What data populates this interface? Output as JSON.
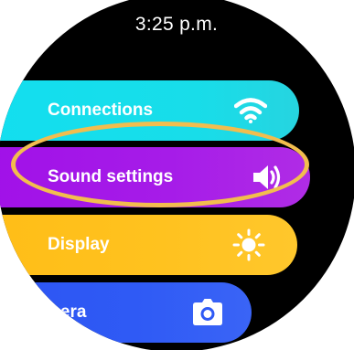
{
  "status_bar": {
    "time": "3:25 p.m."
  },
  "menu": {
    "items": [
      {
        "label": "Connections",
        "icon": "wifi-icon",
        "color": "#18dde9"
      },
      {
        "label": "Sound settings",
        "icon": "speaker-icon",
        "color": "#a61ce8"
      },
      {
        "label": "Display",
        "icon": "brightness-icon",
        "color": "#ffc21f"
      },
      {
        "label": "mera",
        "icon": "camera-icon",
        "color": "#2f5af5"
      }
    ]
  },
  "highlight": {
    "color": "#f2bd4e",
    "target": "Sound settings"
  }
}
